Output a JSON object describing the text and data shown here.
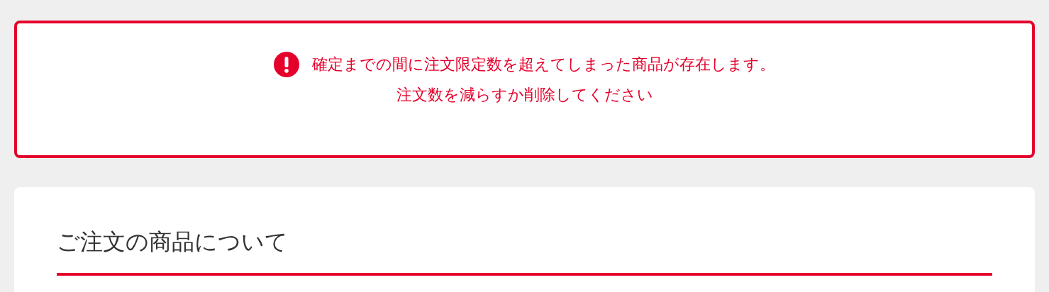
{
  "alert": {
    "lines": [
      "確定までの間に注文限定数を超えてしまった商品が存在します。",
      "注文数を減らすか削除してください"
    ]
  },
  "section": {
    "title": "ご注文の商品について"
  }
}
